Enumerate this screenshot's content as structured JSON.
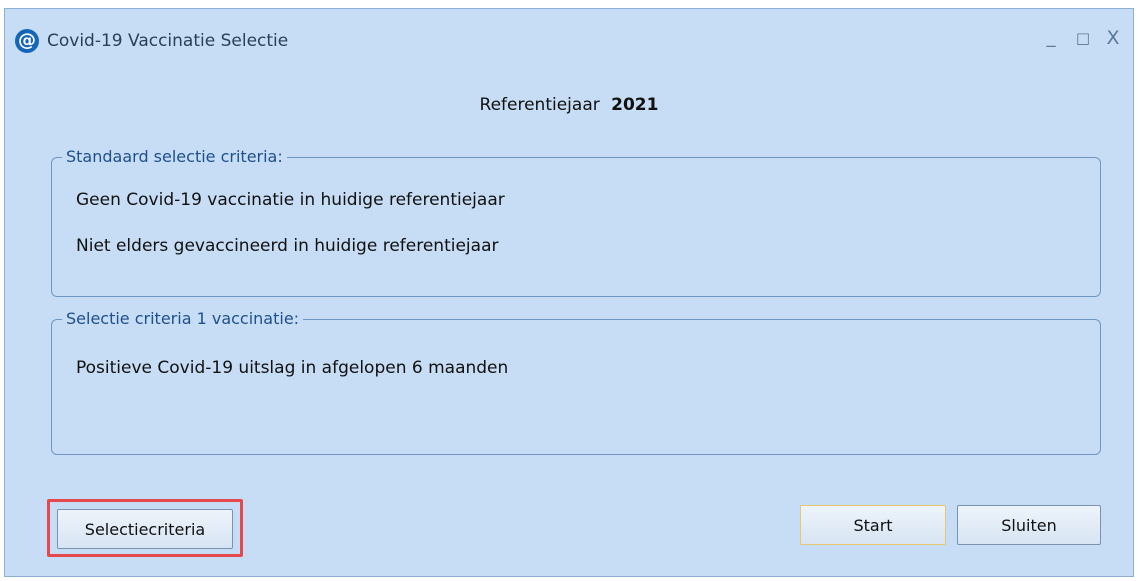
{
  "window": {
    "title": "Covid-19 Vaccinatie Selectie",
    "icon": "at-sign-icon",
    "controls": {
      "minimize": "_",
      "maximize": "□",
      "close": "X"
    }
  },
  "reference": {
    "label": "Referentiejaar",
    "year": "2021"
  },
  "groups": [
    {
      "legend": "Standaard selectie criteria:",
      "items": [
        "Geen Covid-19 vaccinatie in huidige referentiejaar",
        "Niet elders gevaccineerd in huidige referentiejaar"
      ]
    },
    {
      "legend": "Selectie criteria 1 vaccinatie:",
      "items": [
        "Positieve Covid-19 uitslag in afgelopen 6 maanden"
      ]
    }
  ],
  "buttons": {
    "selection_criteria": "Selectiecriteria",
    "start": "Start",
    "close": "Sluiten"
  },
  "colors": {
    "window_background": "#c7ddf5",
    "highlight_border": "#e5484d",
    "legend_text": "#1f4f8c"
  }
}
